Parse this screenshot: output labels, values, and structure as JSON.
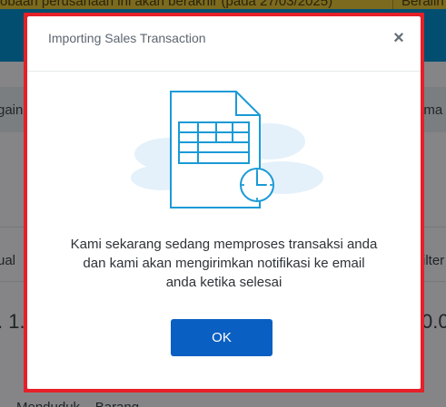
{
  "background": {
    "banner_text": "obaan perusahaan ini akan berakhir (pada 27/03/2025)",
    "banner_right": "Beralih P",
    "left_label_1": "gain",
    "right_label_1": "ama",
    "left_label_2": "ual",
    "right_label_2": "ilter",
    "left_value": ". 1.",
    "right_value": "0.0",
    "bottom_text": "Menduduk    Barang"
  },
  "modal": {
    "title": "Importing Sales Transaction",
    "close_symbol": "×",
    "message_line_1": "Kami sekarang sedang memproses transaksi anda",
    "message_line_2": "dan kami akan mengirimkan notifikasi ke email",
    "message_line_3": "anda ketika selesai",
    "ok_label": "OK"
  },
  "colors": {
    "accent": "#0a5fc2",
    "highlight_border": "#e52029",
    "icon_stroke": "#1a9ad6"
  },
  "icons": {
    "illustration": "spreadsheet-document-clock-icon",
    "close": "close-icon"
  }
}
